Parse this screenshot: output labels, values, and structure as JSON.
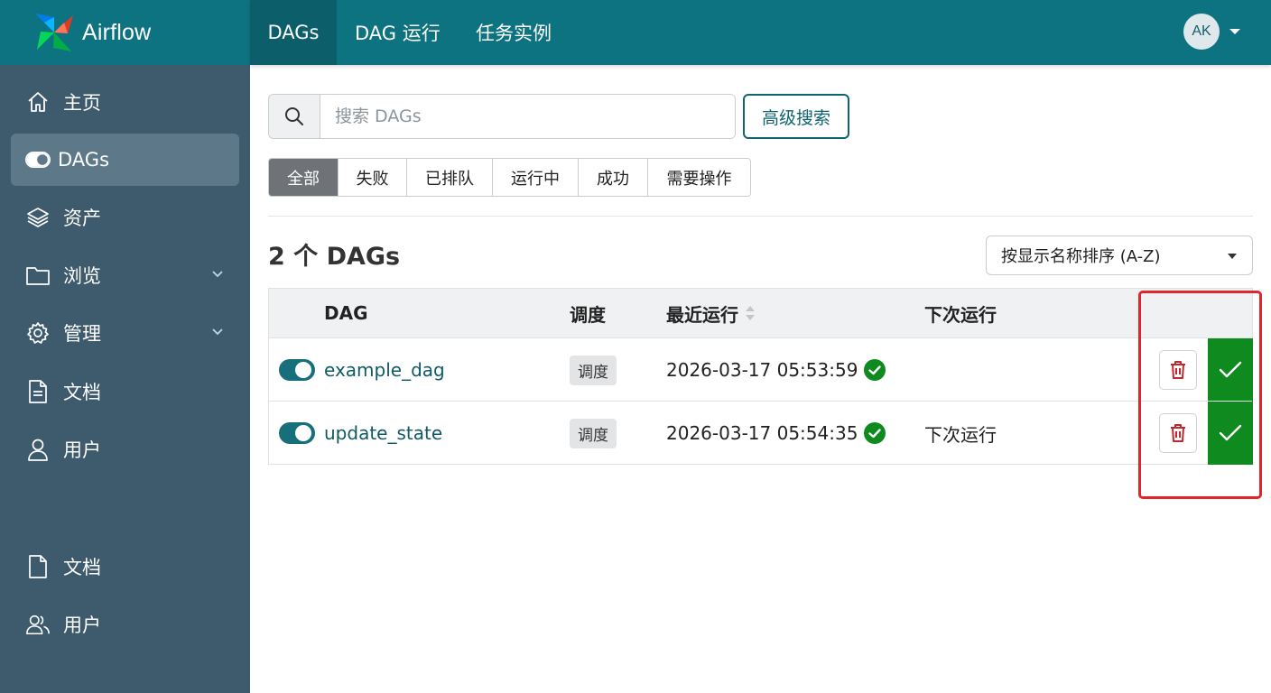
{
  "app": {
    "name": "Airflow"
  },
  "topbar": {
    "tabs": [
      {
        "label": "DAGs",
        "active": true
      },
      {
        "label": "DAG 运行",
        "active": false
      },
      {
        "label": "任务实例",
        "active": false
      }
    ],
    "user_initials": "AK"
  },
  "sidebar": {
    "items": [
      {
        "label": "主页",
        "icon": "home-icon"
      },
      {
        "label": "DAGs",
        "icon": "toggle-icon",
        "active": true
      },
      {
        "label": "资产",
        "icon": "layers-icon"
      },
      {
        "label": "浏览",
        "icon": "folder-icon",
        "has_submenu": true
      },
      {
        "label": "管理",
        "icon": "gear-icon",
        "has_submenu": true
      },
      {
        "label": "文档",
        "icon": "document-icon"
      },
      {
        "label": "用户",
        "icon": "user-icon"
      }
    ],
    "bottom_items": [
      {
        "label": "文档",
        "icon": "file-icon"
      },
      {
        "label": "用户",
        "icon": "users-icon"
      }
    ]
  },
  "search": {
    "placeholder": "搜索 DAGs",
    "value": "",
    "advanced_label": "高级搜索"
  },
  "filters": [
    {
      "label": "全部",
      "active": true
    },
    {
      "label": "失败"
    },
    {
      "label": "已排队"
    },
    {
      "label": "运行中"
    },
    {
      "label": "成功"
    },
    {
      "label": "需要操作"
    }
  ],
  "results": {
    "count_title": "2 个 DAGs",
    "sort_label": "按显示名称排序 (A-Z)"
  },
  "table": {
    "columns": [
      "DAG",
      "调度",
      "最近运行",
      "下次运行"
    ],
    "rows": [
      {
        "dag_id": "example_dag",
        "schedule": "调度",
        "last_run": "2026-03-17 05:53:59",
        "last_run_status": "success",
        "next_run": "",
        "enabled": true
      },
      {
        "dag_id": "update_state",
        "schedule": "调度",
        "last_run": "2026-03-17 05:54:35",
        "last_run_status": "success",
        "next_run": "下次运行",
        "enabled": true
      }
    ]
  },
  "colors": {
    "topbar": "#0e7381",
    "sidebar": "#3e5b6d",
    "success": "#0e8a1e",
    "danger": "#c0282d",
    "highlight": "#e0252b"
  }
}
